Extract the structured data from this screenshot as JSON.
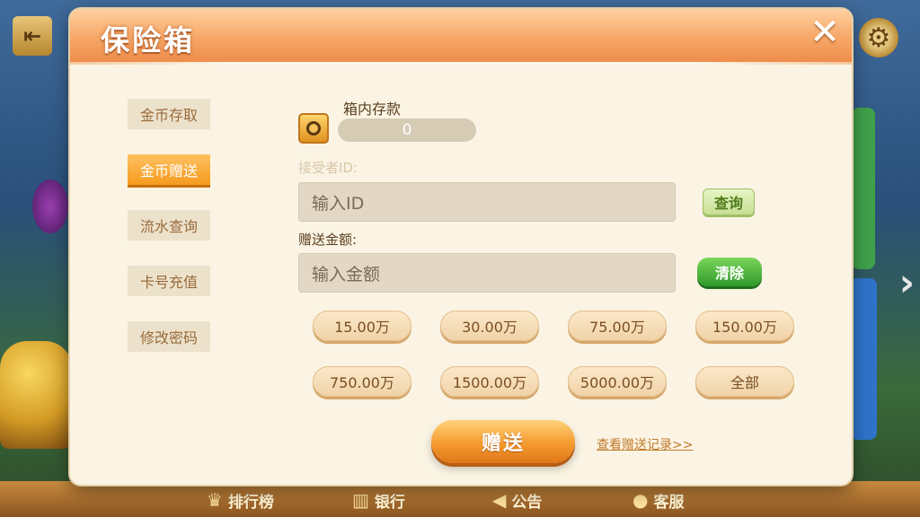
{
  "modal": {
    "title": "保险箱",
    "close_symbol": "✕"
  },
  "side_menu": {
    "items": [
      {
        "label": "金币存取",
        "active": false
      },
      {
        "label": "金币赠送",
        "active": true
      },
      {
        "label": "流水查询",
        "active": false
      },
      {
        "label": "卡号充值",
        "active": false
      },
      {
        "label": "修改密码",
        "active": false
      }
    ]
  },
  "safe": {
    "label": "箱内存款",
    "value": "0",
    "icon": "coin-icon"
  },
  "recipient": {
    "label": "接受者ID:",
    "placeholder": "输入ID",
    "query_label": "查询"
  },
  "amount": {
    "label": "赠送金额:",
    "placeholder": "输入金额",
    "clear_label": "清除",
    "presets": [
      "15.00万",
      "30.00万",
      "75.00万",
      "150.00万",
      "750.00万",
      "1500.00万",
      "5000.00万",
      "全部"
    ]
  },
  "actions": {
    "send_label": "赠送",
    "history_link": "查看赠送记录>>"
  },
  "background": {
    "bottom_nav": [
      {
        "label": "排行榜",
        "icon": "crown-icon"
      },
      {
        "label": "银行",
        "icon": "bank-icon"
      },
      {
        "label": "公告",
        "icon": "megaphone-icon"
      },
      {
        "label": "客服",
        "icon": "headset-icon"
      }
    ]
  },
  "colors": {
    "header_orange": "#f6a766",
    "modal_bg": "#fbf4e4",
    "active_tab": "#f59b1e",
    "send_button": "#f59a2e",
    "clear_button": "#2f9a2a"
  }
}
